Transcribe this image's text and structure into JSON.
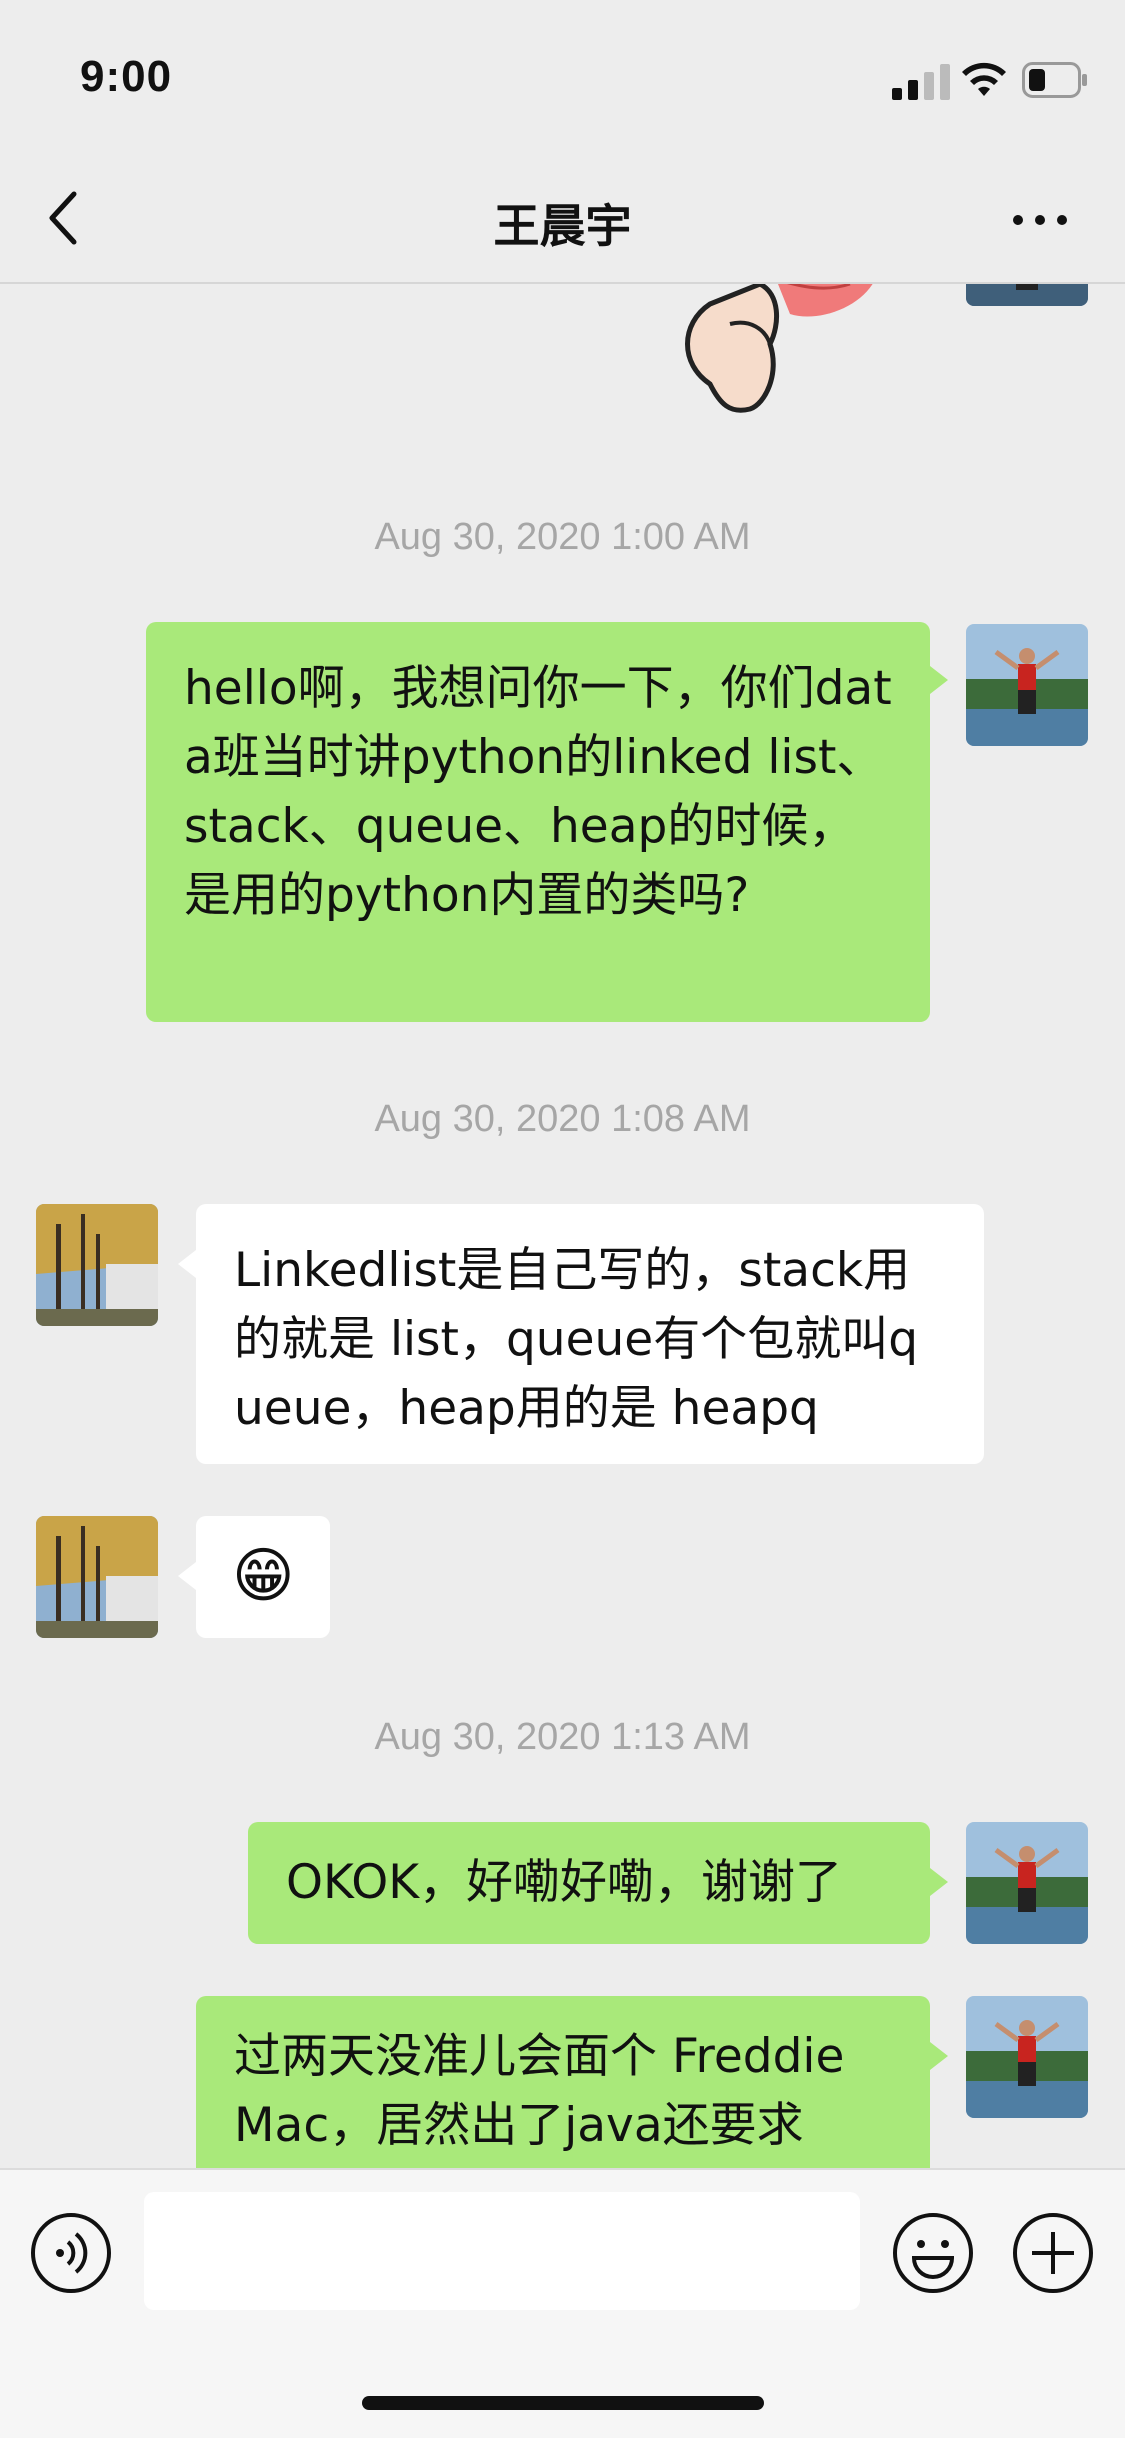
{
  "status_bar": {
    "time": "9:00"
  },
  "nav": {
    "title": "王晨宇"
  },
  "messages": {
    "ts1": "Aug 30, 2020 1:00 AM",
    "m1": "hello啊，我想问你一下，你们data班当时讲python的linked list、stack、queue、heap的时候，是用的python内置的类吗?",
    "ts2": "Aug 30, 2020 1:08 AM",
    "m2": "Linkedlist是自己写的，stack用的就是 list，queue有个包就叫queue，heap用的是 heapq",
    "m3": "😁",
    "ts3": "Aug 30, 2020 1:13 AM",
    "m4": "OKOK，好嘞好嘞，谢谢了",
    "m5": "过两天没准儿会面个 Freddie Mac，居然出了java还要求"
  },
  "colors": {
    "my_bubble": "#a9e97a",
    "their_bubble": "#ffffff",
    "background": "#ededed",
    "timestamp": "#a6a6a6"
  },
  "icons": [
    "signal-icon",
    "wifi-icon",
    "battery-icon",
    "back-chevron-icon",
    "more-icon",
    "voice-icon",
    "emoji-icon",
    "plus-icon"
  ]
}
